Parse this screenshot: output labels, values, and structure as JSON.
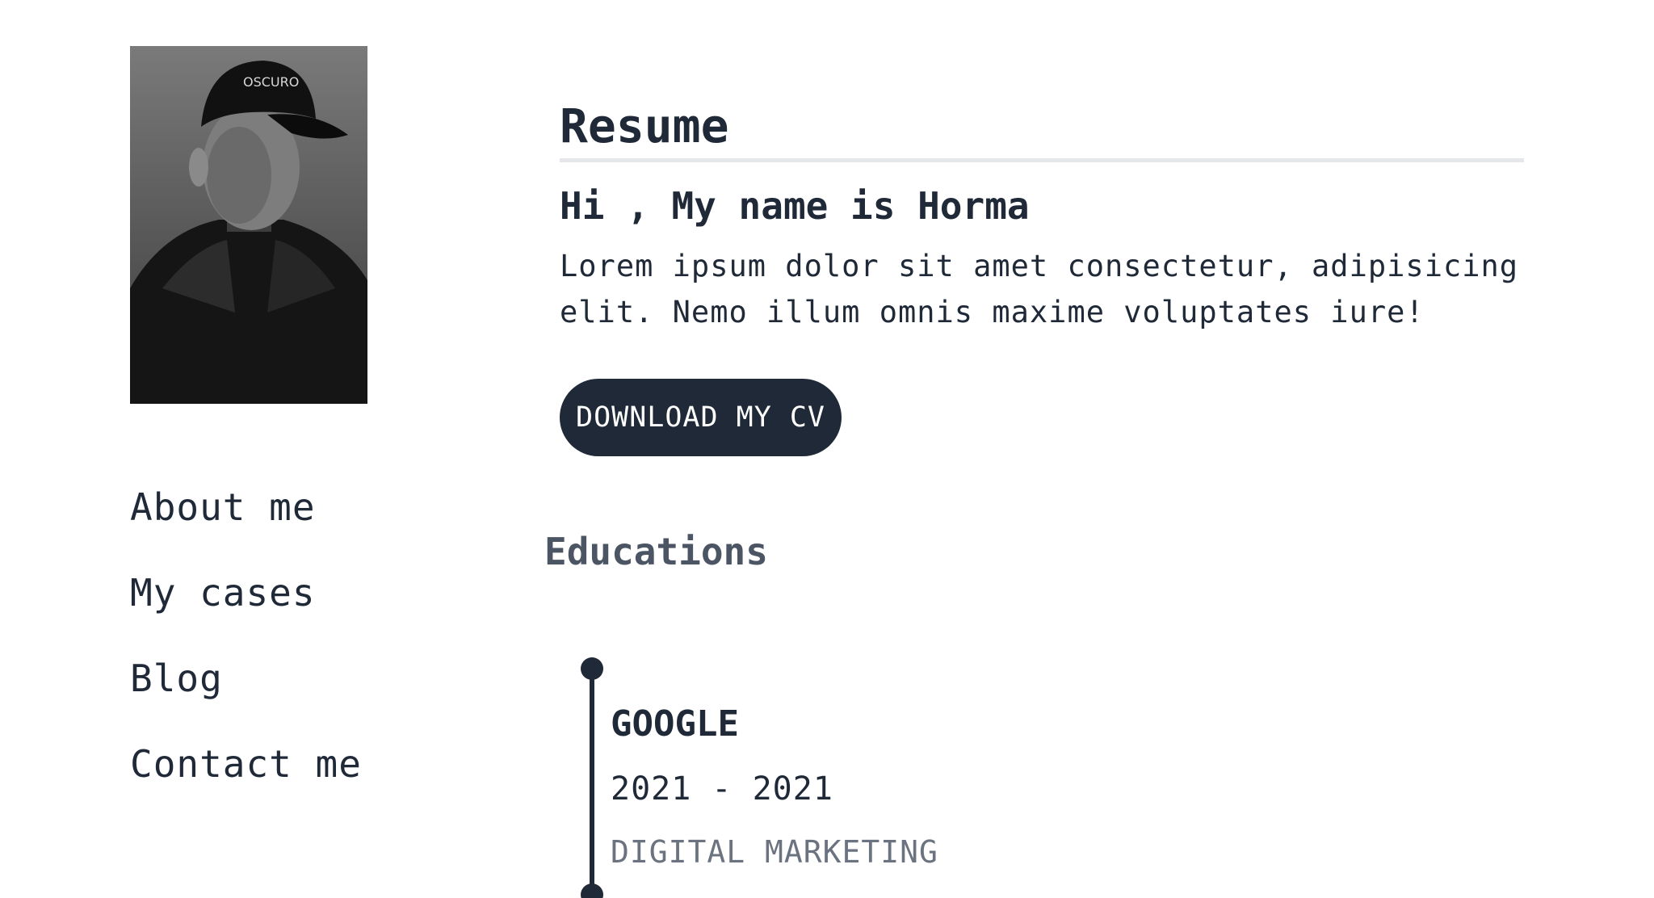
{
  "sidebar": {
    "nav": [
      {
        "label": "About me"
      },
      {
        "label": "My cases"
      },
      {
        "label": "Blog"
      },
      {
        "label": "Contact me"
      }
    ]
  },
  "main": {
    "title": "Resume",
    "greeting": "Hi , My name is Horma",
    "intro": "Lorem ipsum dolor sit amet consectetur, adipisicing elit. Nemo illum omnis maxime voluptates iure!",
    "cv_button": "DOWNLOAD MY CV"
  },
  "education": {
    "heading": "Educations",
    "entries": [
      {
        "company": "GOOGLE",
        "years": "2021 - 2021",
        "role": "DIGITAL MARKETING"
      }
    ]
  },
  "colors": {
    "primary": "#1f2937",
    "muted": "#6b7280",
    "divider": "#e5e7eb"
  }
}
